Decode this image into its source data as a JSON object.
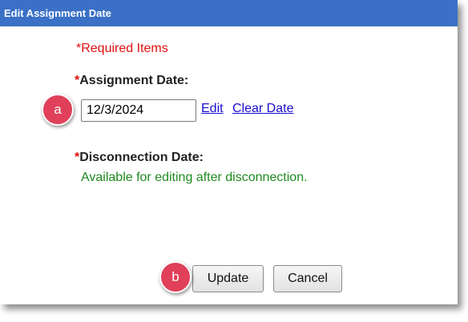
{
  "dialog": {
    "title": "Edit Assignment Date"
  },
  "form": {
    "required_note": "*Required Items",
    "assignment_date": {
      "star": "*",
      "label": "Assignment Date:",
      "value": "12/3/2024",
      "edit_link": "Edit",
      "clear_link": "Clear Date"
    },
    "disconnection_date": {
      "star": "*",
      "label": "Disconnection Date:",
      "note": "Available for editing after disconnection."
    }
  },
  "buttons": {
    "update": "Update",
    "cancel": "Cancel"
  },
  "callouts": {
    "a": "a",
    "b": "b"
  },
  "colors": {
    "title_bar": "#3a70c6",
    "required_red": "#e01010",
    "link_blue": "#1a0dcc",
    "note_green": "#1f8a1f",
    "callout_pink": "#e0405a"
  }
}
